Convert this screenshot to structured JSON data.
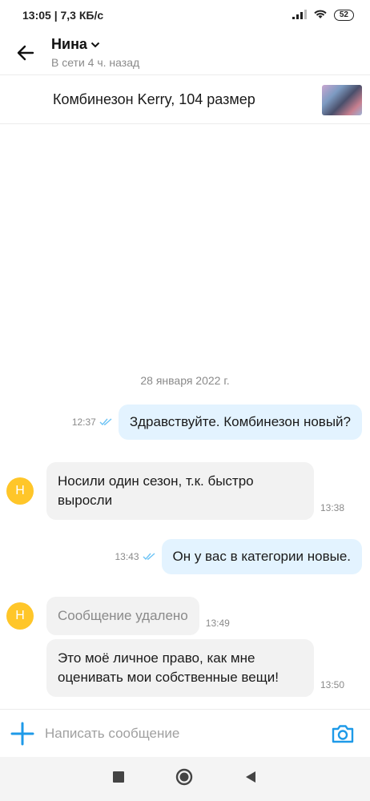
{
  "status_bar": {
    "time_speed": "13:05 | 7,3 КБ/с",
    "battery": "52"
  },
  "header": {
    "contact_name": "Нина",
    "contact_status": "В сети 4 ч. назад"
  },
  "product": {
    "title": "Комбинезон Kerry, 104 размер"
  },
  "chat": {
    "date": "28 января 2022 г.",
    "avatar_letter": "Н",
    "messages": [
      {
        "direction": "out",
        "text": "Здравствуйте. Комбинезон новый?",
        "time": "12:37"
      },
      {
        "direction": "in",
        "text": "Носили один сезон, т.к. быстро выросли",
        "time": "13:38"
      },
      {
        "direction": "out",
        "text": "Он у вас в категории новые.",
        "time": "13:43"
      },
      {
        "direction": "in",
        "text": "Сообщение удалено",
        "time": "13:49",
        "deleted": true
      },
      {
        "direction": "in",
        "text": "Это моё личное право, как мне оценивать мои собственные вещи!",
        "time": "13:50"
      }
    ]
  },
  "composer": {
    "placeholder": "Написать сообщение"
  },
  "colors": {
    "accent": "#1e9ae8",
    "outgoing_bubble": "#e3f3ff",
    "incoming_bubble": "#f2f2f2",
    "avatar": "#ffc629"
  },
  "icons": [
    "back-arrow-icon",
    "chevron-down-icon",
    "read-check-icon",
    "plus-icon",
    "camera-icon",
    "nav-square-icon",
    "nav-circle-icon",
    "nav-back-triangle-icon"
  ]
}
